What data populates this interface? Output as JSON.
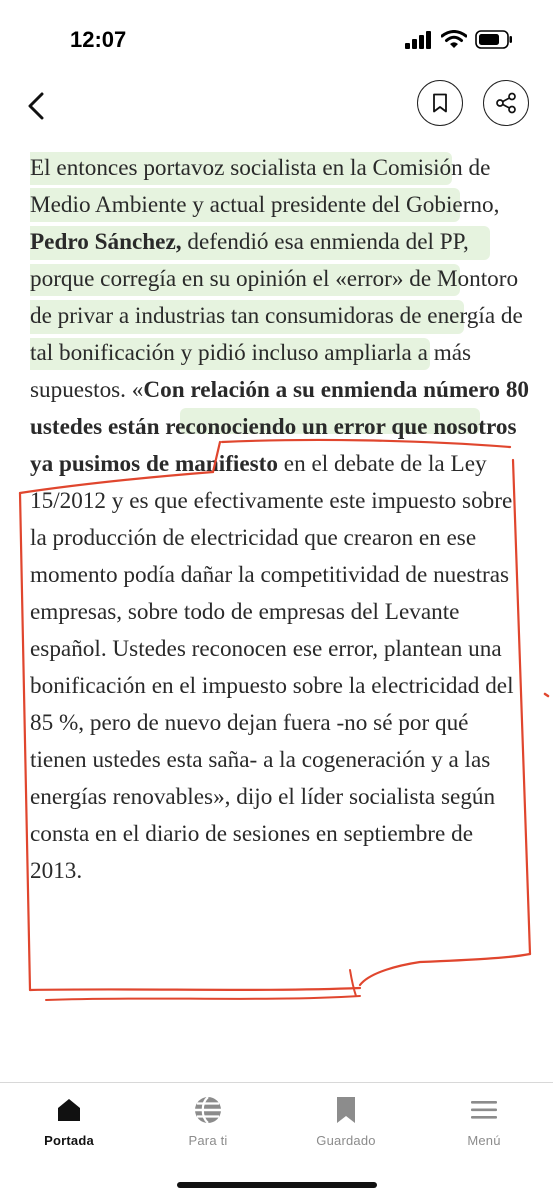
{
  "status_bar": {
    "time": "12:07",
    "icons": [
      "cellular-signal-icon",
      "wifi-icon",
      "battery-icon"
    ]
  },
  "nav": {
    "icons": {
      "back": "chevron-left-icon",
      "bookmark": "bookmark-icon",
      "share": "share-icon"
    }
  },
  "article": {
    "segments": [
      {
        "text": "El entonces portavoz socialista en la Comisión de Medio Ambiente y actual presidente del Gobierno, ",
        "bold": false
      },
      {
        "text": "Pedro Sánchez,",
        "bold": true
      },
      {
        "text": " defendió esa enmienda del PP, porque corregía en su opinión el «error» de Montoro de privar a industrias tan consumidoras de energía de tal bonificación y pidió incluso ampliarla a más supuestos. «",
        "bold": false
      },
      {
        "text": "Con relación a su enmienda número 80 ustedes están reconociendo un error que nosotros ya pusimos de manifiesto",
        "bold": true
      },
      {
        "text": " en el debate de la Ley 15/2012 y es que efectivamente este impuesto sobre la producción de electricidad que crearon en ese momento podía dañar la competitividad de nuestras empresas, sobre todo de empresas del Levante español. Ustedes reconocen ese error, plantean una bonificación en el impuesto sobre la electricidad del 85 %, pero de nuevo dejan fuera -no sé por qué tienen ustedes esta saña- a la cogeneración y a las energías renovables», dijo el líder socialista según consta en el diario de sesiones en septiembre de 2013.",
        "bold": false
      }
    ],
    "highlight_color": "#bce0aa",
    "annotation_color": "#e0462e"
  },
  "tab_bar": {
    "tabs": [
      {
        "label": "Portada",
        "icon": "home-icon",
        "active": true
      },
      {
        "label": "Para ti",
        "icon": "globe-icon",
        "active": false
      },
      {
        "label": "Guardado",
        "icon": "bookmark-icon",
        "active": false
      },
      {
        "label": "Menú",
        "icon": "menu-icon",
        "active": false
      }
    ]
  }
}
